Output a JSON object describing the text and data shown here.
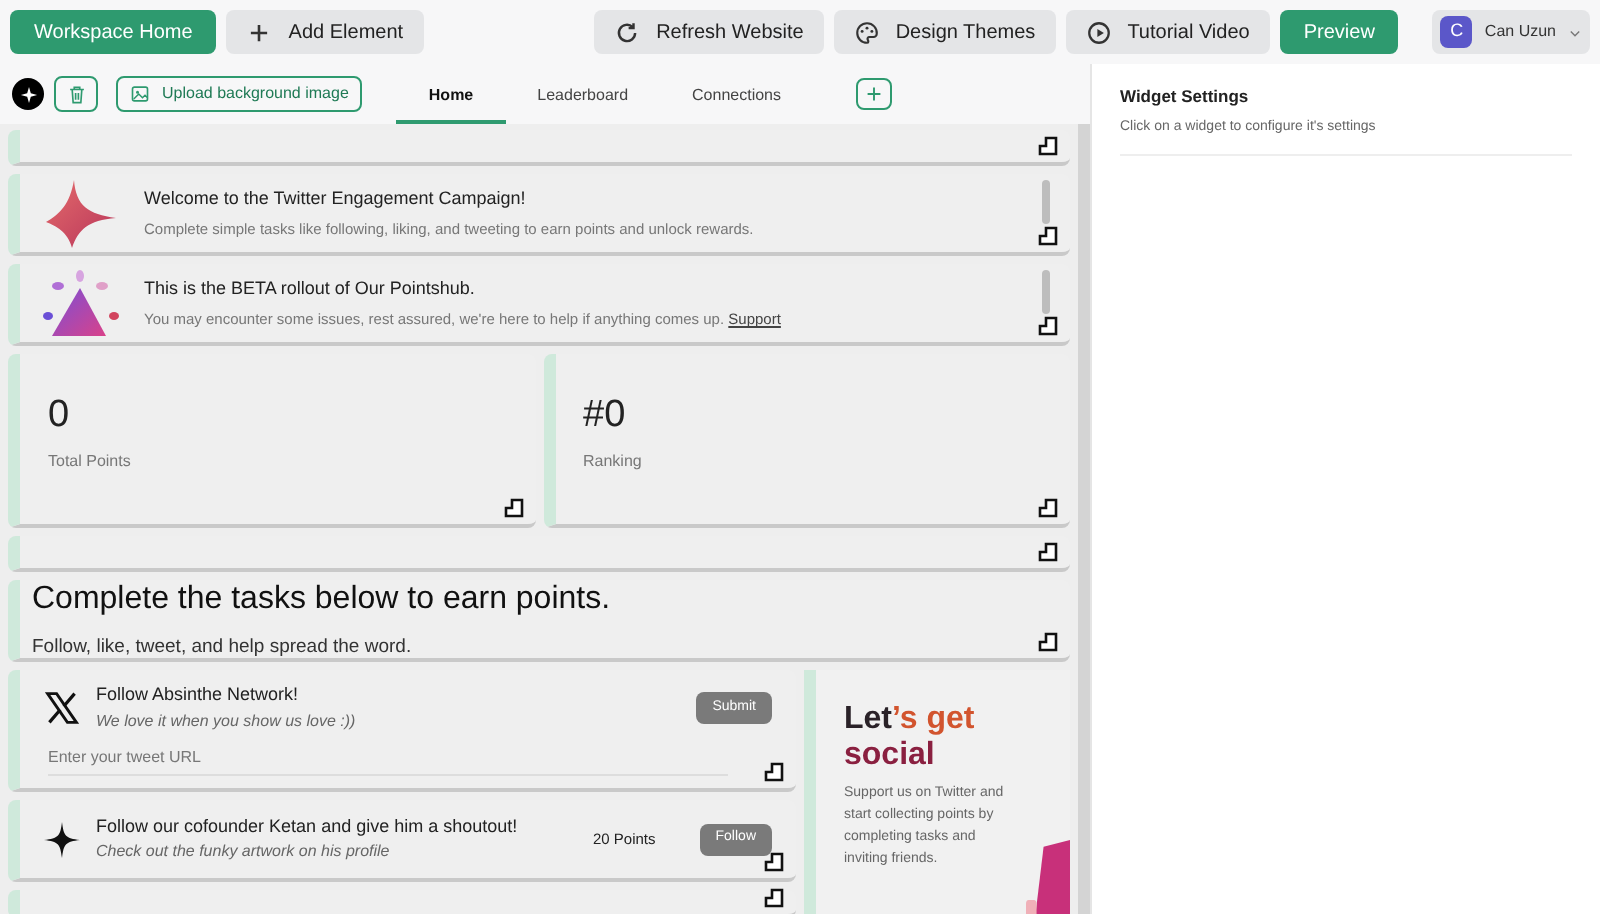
{
  "top_bar": {
    "left_buttons": [
      {
        "label": "Workspace Home",
        "kind": "primary"
      },
      {
        "label": "Add Element",
        "kind": "add"
      }
    ],
    "right_buttons": [
      {
        "label": "Refresh Website",
        "kind": "refresh"
      },
      {
        "label": "Design Themes",
        "kind": "palette"
      },
      {
        "label": "Tutorial Video",
        "kind": "play"
      },
      {
        "label": "Preview",
        "kind": "primary"
      }
    ],
    "user": {
      "initial": "C",
      "name": "Can Uzun"
    }
  },
  "toolbar": {
    "upload_label": "Upload background image",
    "tabs": [
      {
        "label": "Home",
        "selected": true
      },
      {
        "label": "Leaderboard",
        "selected": false
      },
      {
        "label": "Connections",
        "selected": false
      }
    ]
  },
  "banners": [
    {
      "kind": "star",
      "title": "Welcome to the Twitter Engagement Campaign!",
      "text": "Complete simple tasks like following, liking, and tweeting to earn points and unlock rewards."
    },
    {
      "kind": "triangle",
      "title": "This is the BETA rollout of Our Pointshub.",
      "text": "You may encounter some issues, rest assured, we're here to help if anything comes up.",
      "link": "Support"
    }
  ],
  "stats": [
    {
      "value": "0",
      "label": "Total Points"
    },
    {
      "value": "#0",
      "label": "Ranking"
    }
  ],
  "heading": {
    "title": "Complete the tasks below to earn points.",
    "subtitle": "Follow, like, tweet, and help spread the word."
  },
  "tasks": [
    {
      "kind": "x",
      "title": "Follow Absinthe Network!",
      "subtitle": "We love it when you show us love :))",
      "button": "Submit",
      "placeholder": "Enter your tweet URL"
    },
    {
      "kind": "sparkle",
      "title": "Follow our cofounder Ketan and give him a shoutout!",
      "subtitle": "Check out the funky artwork on his profile",
      "points": "20 Points",
      "button": "Follow"
    }
  ],
  "social": {
    "title_start": "Let",
    "title_accent": "’s get",
    "title_end": "social",
    "text": "Support us on Twitter and start collecting points by completing tasks and inviting friends."
  },
  "settings": {
    "title": "Widget Settings",
    "hint": "Click on a widget to configure it's settings"
  }
}
